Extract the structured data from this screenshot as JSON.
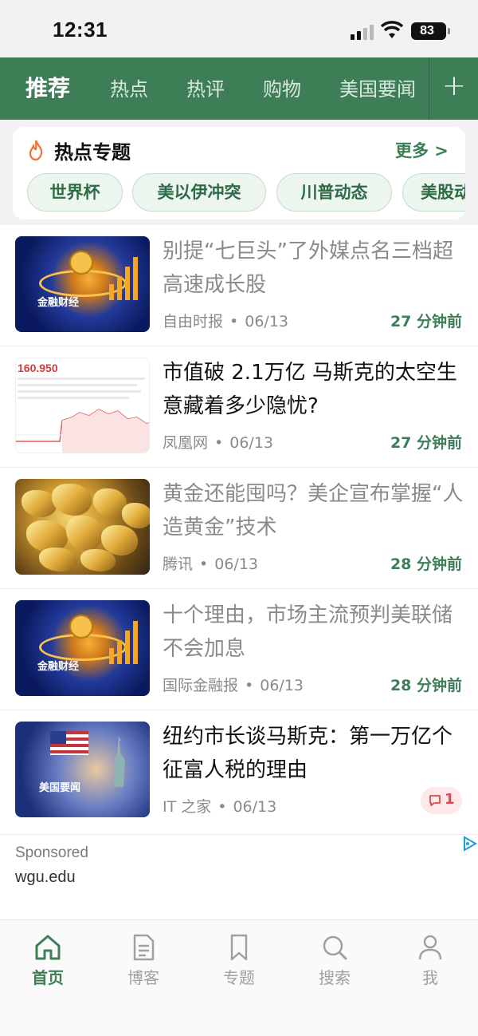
{
  "status_bar": {
    "time": "12:31",
    "battery": "83"
  },
  "nav": {
    "tabs": [
      "推荐",
      "热点",
      "热评",
      "购物",
      "美国要闻"
    ],
    "add_icon": "plus-icon"
  },
  "hot_topics": {
    "title": "热点专题",
    "more": "更多 >",
    "chips": [
      "世界杯",
      "美以伊冲突",
      "川普动态",
      "美股动"
    ]
  },
  "articles": [
    {
      "title": "别提“七巨头”了外媒点名三档超高速成长股",
      "source": "自由时报",
      "date": "06/13",
      "ago": "27 分钟前",
      "thumb_label": "金融财经",
      "read": true
    },
    {
      "title": "市值破 2.1万亿 马斯克的太空生意藏着多少隐忧?",
      "source": "凤凰网",
      "date": "06/13",
      "ago": "27 分钟前",
      "thumb_price": "160.950",
      "read": false
    },
    {
      "title": "黄金还能囤吗？美企宣布掌握“人造黄金”技术",
      "source": "腾讯",
      "date": "06/13",
      "ago": "28 分钟前",
      "read": true
    },
    {
      "title": "十个理由，市场主流预判美联储不会加息",
      "source": "国际金融报",
      "date": "06/13",
      "ago": "28 分钟前",
      "thumb_label": "金融财经",
      "read": true
    },
    {
      "title": "纽约市长谈马斯克：第一万亿个征富人税的理由",
      "source": "IT 之家",
      "date": "06/13",
      "comments": "1",
      "thumb_label": "美国要闻",
      "read": false
    }
  ],
  "sponsored": {
    "label": "Sponsored",
    "domain": "wgu.edu"
  },
  "bottom_nav": [
    {
      "label": "首页",
      "icon": "home-icon",
      "active": true
    },
    {
      "label": "博客",
      "icon": "document-icon",
      "active": false
    },
    {
      "label": "专题",
      "icon": "bookmark-icon",
      "active": false
    },
    {
      "label": "搜索",
      "icon": "search-icon",
      "active": false
    },
    {
      "label": "我",
      "icon": "person-icon",
      "active": false
    }
  ],
  "colors": {
    "brand_green": "#3d7e57",
    "comment_red": "#e0484e"
  }
}
